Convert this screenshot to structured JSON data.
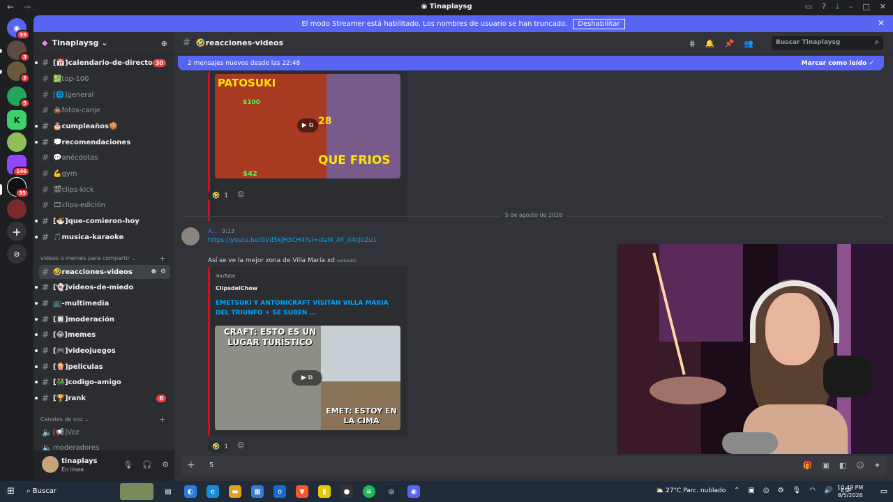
{
  "window": {
    "title": "Tinaplaysg",
    "back": "←",
    "forward": "→"
  },
  "banner": {
    "text": "El modo Streamer está habilitado. Los nombres de usuario se han truncado.",
    "button": "Deshabilitar"
  },
  "servers": [
    {
      "label": "",
      "badge": "55"
    },
    {
      "label": "",
      "badge": "3"
    },
    {
      "label": "",
      "badge": "2"
    },
    {
      "label": "",
      "badge": "5"
    },
    {
      "label": "K",
      "badge": ""
    },
    {
      "label": "",
      "badge": ""
    },
    {
      "label": "",
      "badge": "146"
    },
    {
      "label": "",
      "badge": "35"
    },
    {
      "label": "",
      "badge": ""
    }
  ],
  "sidebar": {
    "server_name": "Tinaplaysg",
    "channels": [
      {
        "label": "[📅]calendario-de-directo",
        "badge": "30"
      },
      {
        "label": "💹top-100",
        "badge": ""
      },
      {
        "label": "[🌐]general",
        "badge": ""
      },
      {
        "label": "💩fotos-canje",
        "badge": ""
      },
      {
        "label": "🎂cumpleaños🍪",
        "badge": ""
      },
      {
        "label": "💭recomendaciones",
        "badge": ""
      },
      {
        "label": "💬anécdotas",
        "badge": ""
      },
      {
        "label": "💪gym",
        "badge": ""
      },
      {
        "label": "🎬clips-kick",
        "badge": ""
      },
      {
        "label": "🎞clips-edición",
        "badge": ""
      },
      {
        "label": "[🍜]que-comieron-hoy",
        "badge": ""
      },
      {
        "label": "🎵musica-karaoke",
        "badge": ""
      }
    ],
    "category": "videos o memes para compartir",
    "channels2": [
      {
        "label": "🤣reacciones-videos",
        "badge": ""
      },
      {
        "label": "[👻]videos-de-miedo",
        "badge": ""
      },
      {
        "label": "📺-multimedia",
        "badge": ""
      },
      {
        "label": "[🔲]moderación",
        "badge": ""
      },
      {
        "label": "[😂]memes",
        "badge": ""
      },
      {
        "label": "[🎮]videojuegos",
        "badge": ""
      },
      {
        "label": "[🍿]peliculas",
        "badge": ""
      },
      {
        "label": "[👬]codigo-amigo",
        "badge": ""
      },
      {
        "label": "[🏆]rank",
        "badge": "6"
      }
    ],
    "voice_category": "Canales de voz",
    "voice": [
      {
        "label": "[📢]Voz"
      },
      {
        "label": "moderadores"
      }
    ]
  },
  "user": {
    "name": "tinaplays",
    "status": "En línea"
  },
  "channel": {
    "name": "🤣reacciones-videos",
    "search_placeholder": "Buscar Tinaplaysg",
    "new_messages": "2 mensajes nuevos desde las 22:48",
    "mark_read": "Marcar como leído"
  },
  "messages": {
    "thumb1_top": "PATOSUKI",
    "thumb1_bottom": "QUE FRIOS",
    "thumb1_money": "$100",
    "thumb1_money2": "$42",
    "thumb1_num": "28",
    "reaction1": "1",
    "date_divider": "5 de agosto de 2026",
    "author": "A...",
    "time": "9:13",
    "link": "https://youtu.be/GVd5kjH3CH4?si=olaM_AY_d4cJbZu1",
    "text": "Así se ve la mejor zona de Villa María xd",
    "edited": "(editado)",
    "embed_provider": "YouTube",
    "embed_author": "ClipsdelChow",
    "embed_title": "EMETSUKI Y ANTONICRAFT  VISITAN VILLA MARIA DEL TRIUNFO + SE SUBEN ...",
    "thumb2_top": "CRAFT: ESTO ES UN LUGAR TURÍSTICO",
    "thumb2_bottom": "EMET: ESTOY EN LA CIMA",
    "reaction2": "1"
  },
  "composer": {
    "value": "5"
  },
  "taskbar": {
    "search": "Buscar",
    "weather": "27°C  Parc. nublado",
    "lang": "ESP",
    "time": "10:49 PM",
    "date": "8/5/2026"
  }
}
